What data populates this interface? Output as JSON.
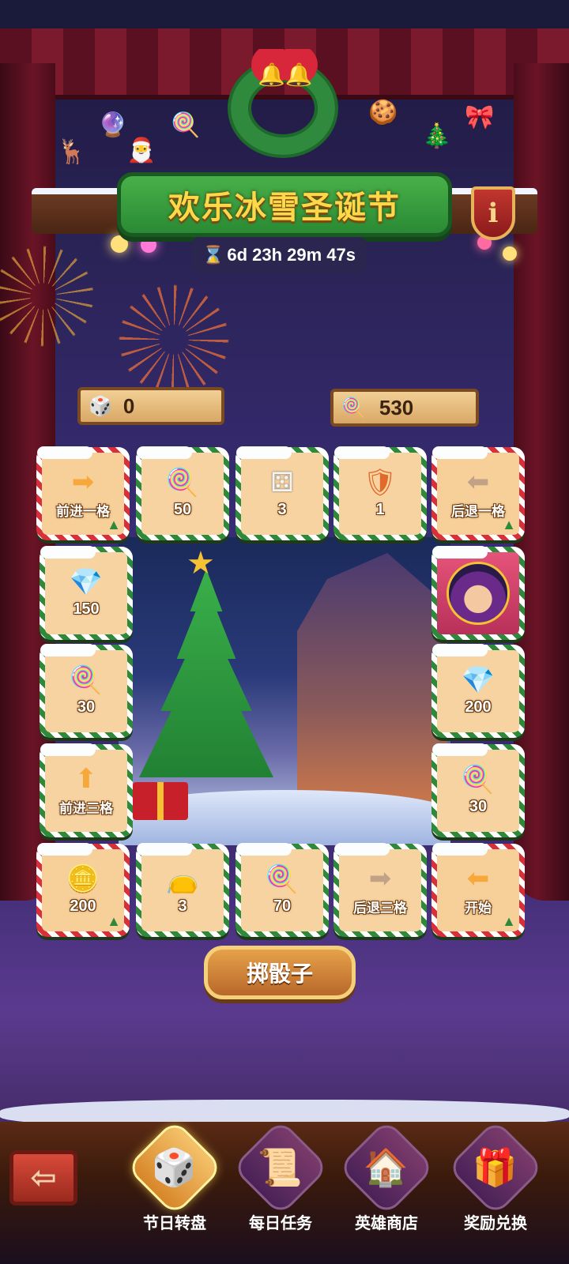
{
  "event": {
    "title": "欢乐冰雪圣诞节",
    "timer_icon": "hourglass-icon",
    "timer": "6d 23h 29m 47s",
    "info_label": "i"
  },
  "counters": {
    "dice": {
      "icon": "dice-icon",
      "value": "0"
    },
    "candy": {
      "icon": "candy-cane-icon",
      "value": "530"
    }
  },
  "board": {
    "top_row": [
      {
        "icon": "arrow-right-icon",
        "glyph": "➡",
        "label": "前进一格",
        "kind": "corner"
      },
      {
        "icon": "candy-cane-icon",
        "glyph": "🍭",
        "label": "50"
      },
      {
        "icon": "dice-icon",
        "glyph": "⚄",
        "label": "3"
      },
      {
        "icon": "hero-crest-icon",
        "glyph": "🛡",
        "label": "1"
      },
      {
        "icon": "arrow-left-icon",
        "glyph": "⬅",
        "label": "后退一格",
        "kind": "corner"
      }
    ],
    "left_col": [
      {
        "icon": "diamond-icon",
        "glyph": "💎",
        "label": "150"
      },
      {
        "icon": "candy-cane-icon",
        "glyph": "🍭",
        "label": "30"
      },
      {
        "icon": "arrow-up-icon",
        "glyph": "⬆",
        "label": "前进三格"
      }
    ],
    "right_col": [
      {
        "icon": "hero-portrait-icon",
        "glyph": "",
        "label": ""
      },
      {
        "icon": "diamond-icon",
        "glyph": "💎",
        "label": "200"
      },
      {
        "icon": "candy-cane-icon",
        "glyph": "🍭",
        "label": "30"
      }
    ],
    "bottom_row": [
      {
        "icon": "coin-v-icon",
        "glyph": "🪙",
        "label": "200",
        "kind": "corner"
      },
      {
        "icon": "loot-bag-icon",
        "glyph": "👝",
        "label": "3"
      },
      {
        "icon": "candy-cane-icon",
        "glyph": "🍭",
        "label": "70"
      },
      {
        "icon": "arrow-right-grey-icon",
        "glyph": "➡",
        "label": "后退三格"
      },
      {
        "icon": "arrow-left-icon",
        "glyph": "⬅",
        "label": "开始",
        "kind": "corner"
      }
    ]
  },
  "roll_button": "掷骰子",
  "bottom_nav": {
    "back_icon": "back-arrow-icon",
    "items": [
      {
        "label": "节日转盘",
        "icon": "board-game-icon",
        "active": true
      },
      {
        "label": "每日任务",
        "icon": "scroll-quest-icon",
        "active": false
      },
      {
        "label": "英雄商店",
        "icon": "shop-house-icon",
        "active": false
      },
      {
        "label": "奖励兑换",
        "icon": "gift-box-icon",
        "active": false
      }
    ]
  },
  "colors": {
    "accent_gold": "#ffd84a",
    "banner_green": "#2a8a34",
    "tile_bg": "#f7d3a1",
    "candy_red": "#d8303a"
  }
}
